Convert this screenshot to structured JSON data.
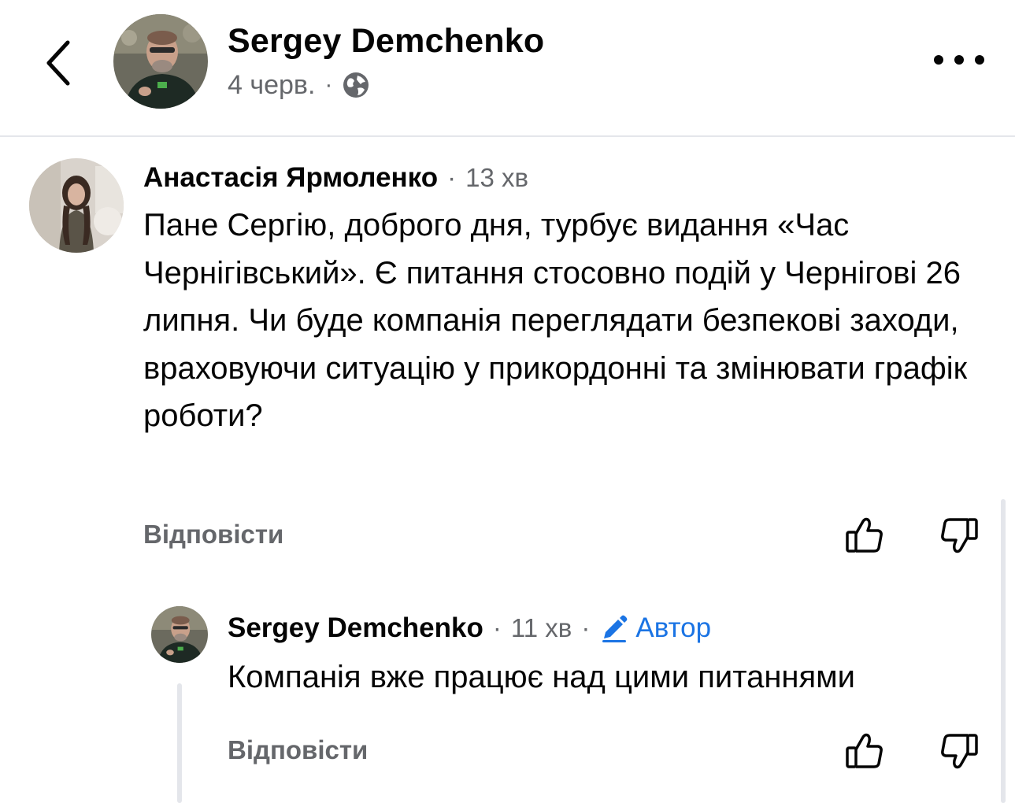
{
  "header": {
    "back_icon": "chevron-left-icon",
    "name": "Sergey Demchenko",
    "date": "4 черв.",
    "separator": "·",
    "privacy_icon": "globe-icon",
    "more_icon": "more-horizontal-icon"
  },
  "comment": {
    "author": "Анастасія Ярмоленко",
    "separator": "·",
    "time": "13 хв",
    "text": "Пане Сергію, доброго дня, турбує видання «Час Чернігівський». Є питання стосовно подій у Чернігові 26 липня. Чи буде компанія переглядати безпекові заходи, враховуючи ситуацію у прикордонні та змінювати графік роботи?",
    "reply_label": "Відповісти",
    "like_icon": "thumbs-up-icon",
    "dislike_icon": "thumbs-down-icon"
  },
  "reply": {
    "author": "Sergey Demchenko",
    "separator1": "·",
    "time": "11 хв",
    "separator2": "·",
    "badge_icon": "pencil-icon",
    "badge_label": "Автор",
    "text": "Компанія вже працює над цими питаннями",
    "reply_label": "Відповісти",
    "like_icon": "thumbs-up-icon",
    "dislike_icon": "thumbs-down-icon"
  },
  "colors": {
    "text": "#050505",
    "secondary": "#65676b",
    "accent": "#1b74e4",
    "divider": "#e4e6eb"
  }
}
